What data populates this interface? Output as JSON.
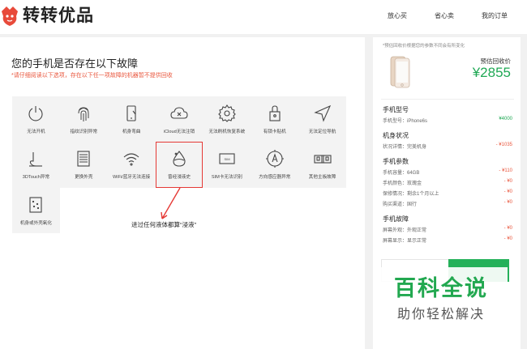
{
  "header": {
    "brand": "转转优品",
    "nav": [
      "放心买",
      "省心卖",
      "我的订单"
    ]
  },
  "question": {
    "title": "您的手机是否存在以下故障",
    "note": "*请仔细阅读以下选项，存在以下任一项故障的机器暂不提供回收"
  },
  "faults": [
    {
      "label": "无法开机",
      "icon": "power-icon"
    },
    {
      "label": "指纹识别异常",
      "icon": "fingerprint-icon"
    },
    {
      "label": "机身弯曲",
      "icon": "bent-phone-icon"
    },
    {
      "label": "iCloud无法注销",
      "icon": "cloud-x-icon"
    },
    {
      "label": "无法刷机恢复系统",
      "icon": "gear-icon"
    },
    {
      "label": "有锁卡贴机",
      "icon": "lock-icon"
    },
    {
      "label": "无法定位导航",
      "icon": "navigation-icon"
    },
    {
      "label": "3DTouch异常",
      "icon": "touch-icon"
    },
    {
      "label": "更换外壳",
      "icon": "shell-icon"
    },
    {
      "label": "WiFi/蓝牙无法连接",
      "icon": "wifi-icon"
    },
    {
      "label": "曾经浸液史",
      "icon": "water-drop-icon",
      "selected": true
    },
    {
      "label": "SIM卡无法识别",
      "icon": "sim-icon"
    },
    {
      "label": "方向感应器异常",
      "icon": "compass-icon"
    },
    {
      "label": "其他主板故障",
      "icon": "board-icon"
    },
    {
      "label": "机身或外壳氧化",
      "icon": "oxidation-icon"
    }
  ],
  "annotation": "进过任何液体都算“浸液”",
  "side": {
    "note": "*预估回收价根据您的参数不同会有所变化",
    "price_label": "预估回收价",
    "price": "¥2855",
    "sections": [
      {
        "title": "手机型号",
        "rows": [
          {
            "k": "手机型号：iPhone6s",
            "v": "¥4000",
            "tone": "green"
          }
        ]
      },
      {
        "title": "机身状况",
        "rows": [
          {
            "k": "状况详情：完美机身",
            "v": "- ¥1035",
            "tone": "red"
          }
        ]
      },
      {
        "title": "手机参数",
        "rows": [
          {
            "k": "手机容量：64GB",
            "v": "- ¥110",
            "tone": "red"
          },
          {
            "k": "手机颜色：玫瑰金",
            "v": "- ¥0",
            "tone": "red"
          },
          {
            "k": "保修情况：剩余1个月以上",
            "v": "- ¥0",
            "tone": "red"
          },
          {
            "k": "购买渠道：国行",
            "v": "- ¥0",
            "tone": "red"
          }
        ]
      },
      {
        "title": "手机故障",
        "rows": [
          {
            "k": "屏幕外观：外观正常",
            "v": "- ¥0",
            "tone": "red"
          },
          {
            "k": "屏幕显示：显示正常",
            "v": "- ¥0",
            "tone": "red"
          }
        ]
      }
    ]
  },
  "watermark": {
    "line1": "百科全说",
    "line2": "助你轻松解决"
  },
  "colors": {
    "accent": "#1fa854",
    "warn": "#e9573e",
    "select": "#e53935"
  }
}
